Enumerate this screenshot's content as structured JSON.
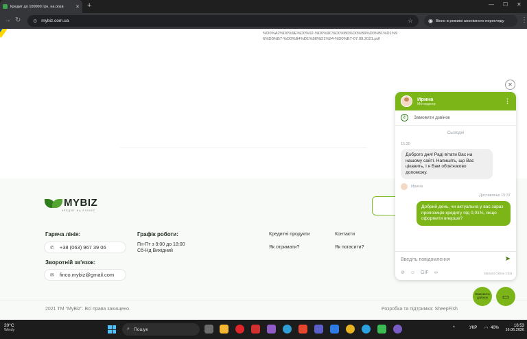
{
  "browser": {
    "tab_title": "Кредит до 100000 грн. на розв",
    "tab_close": "✕",
    "new_tab": "+",
    "url": "mybiz.com.ua",
    "incognito_label": "Вікно в режимі анонімного перегляду",
    "menu_dots": "⋮"
  },
  "page": {
    "url_fragment": "%D0%A2%D0%9E%D0%92-%D0%9C%D0%B0%D0%B9%D0%B1%D1%96%D0%B7-%D0%B4%D1%96%D1%94-%D0%B7-07.09.2021.pdf"
  },
  "footer": {
    "logo_text": "MYBIZ",
    "logo_sub": "КРЕДИТ НА БІЗНЕС",
    "hotline_title": "Гаряча лінія:",
    "phone": "+38 (063) 967 39 06",
    "feedback_title": "Зворотній зв'язок:",
    "email": "finco.mybiz@gmail.com",
    "schedule_title": "Графік роботи:",
    "schedule_weekdays": "Пн-Пт з 9:00 до 18:00",
    "schedule_weekend": "Сб-Нд Вихідний",
    "links": {
      "credit_products": "Кредитні продукти",
      "contacts": "Контакти",
      "how_to_get": "Як отримати?",
      "how_to_repay": "Як погасити?"
    },
    "copyright": "2021 ТМ \"MyBiz\". Всі права захищено.",
    "developer": "Розробка та підтримка: SheepFish"
  },
  "chat": {
    "agent_name": "Ирина",
    "agent_role": "Менеджер",
    "order_call": "Замовити дзвінок",
    "day_separator": "Сьогодні",
    "time_in": "15:35",
    "message_in": "Доброго дня! Раді вітати Вас на нашому сайті. Напишіть, що Вас цікавить, і я Вам обов'язково допоможу.",
    "agent_label": "Ирина",
    "delivered_status": "Доставлено 15:37",
    "message_out": "Добрий день, чи актуальна у вас зараз пропозиція кредиту під 0,01%, якщо оформити вперше?",
    "input_placeholder": "Введіть повідомлення",
    "gif_label": "GIF",
    "brand": "Bitrix24 Online Chat",
    "fab_call_label": "Замовити дзвінок"
  },
  "taskbar": {
    "temp": "20°C",
    "weather": "Windy",
    "search_label": "Пошук",
    "lang": "УКР",
    "battery": "40%",
    "time": "16:53",
    "date": "16.06.2026"
  },
  "colors": {
    "brand_green": "#7cb518",
    "dark_green": "#2e7d1a"
  }
}
